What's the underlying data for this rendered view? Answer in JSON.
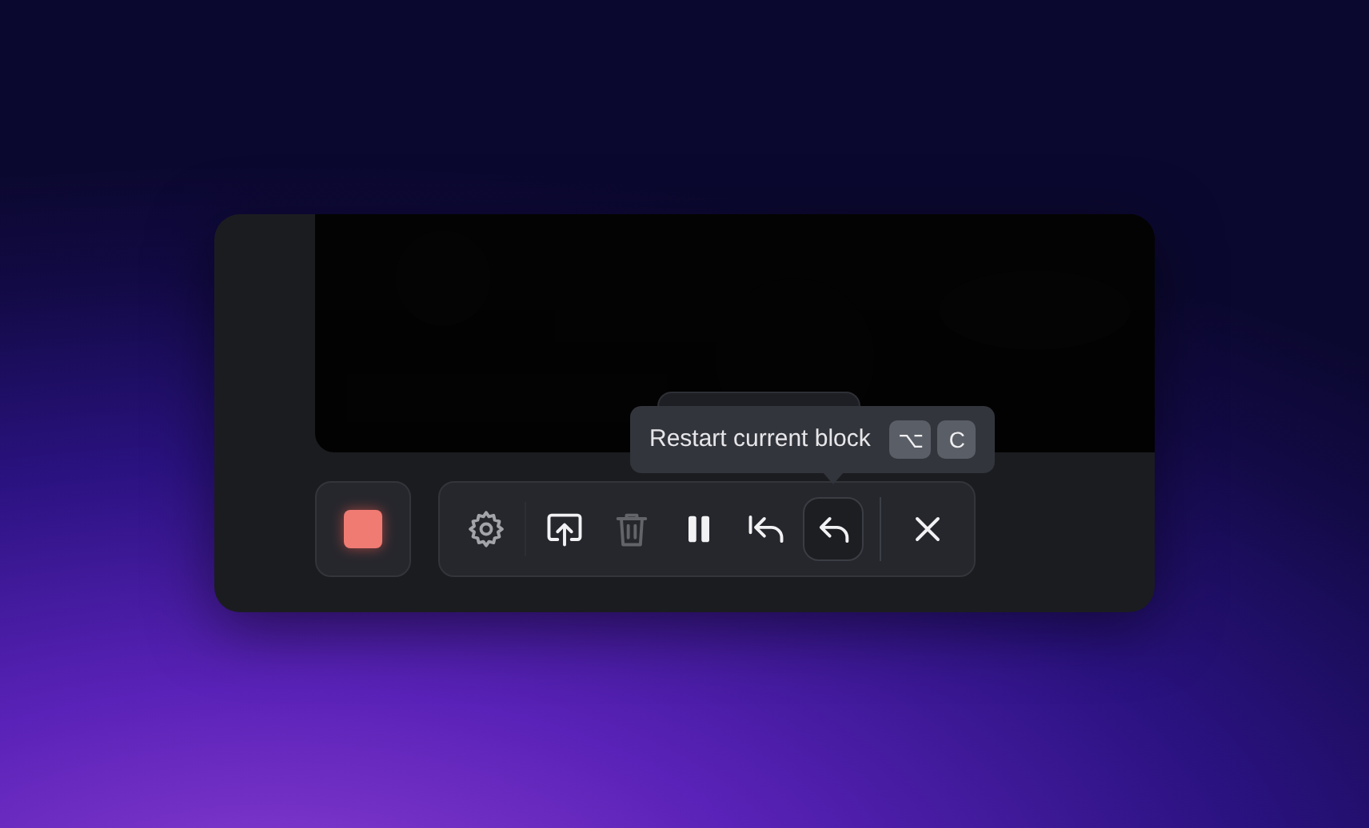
{
  "record_button": {
    "recording": true
  },
  "toolbar": {
    "groups": [
      [
        {
          "kind": "settings",
          "disabled": false,
          "selected": false
        }
      ],
      [
        {
          "kind": "upload",
          "disabled": false,
          "selected": false
        },
        {
          "kind": "delete",
          "disabled": true,
          "selected": false
        },
        {
          "kind": "pause",
          "disabled": false,
          "selected": false
        },
        {
          "kind": "restart-all",
          "disabled": false,
          "selected": false
        },
        {
          "kind": "restart",
          "disabled": false,
          "selected": true
        }
      ],
      [
        {
          "kind": "close",
          "disabled": false,
          "selected": false
        }
      ]
    ]
  },
  "tooltip": {
    "text": "Restart current block",
    "shortcut": [
      "⌥",
      "C"
    ]
  }
}
